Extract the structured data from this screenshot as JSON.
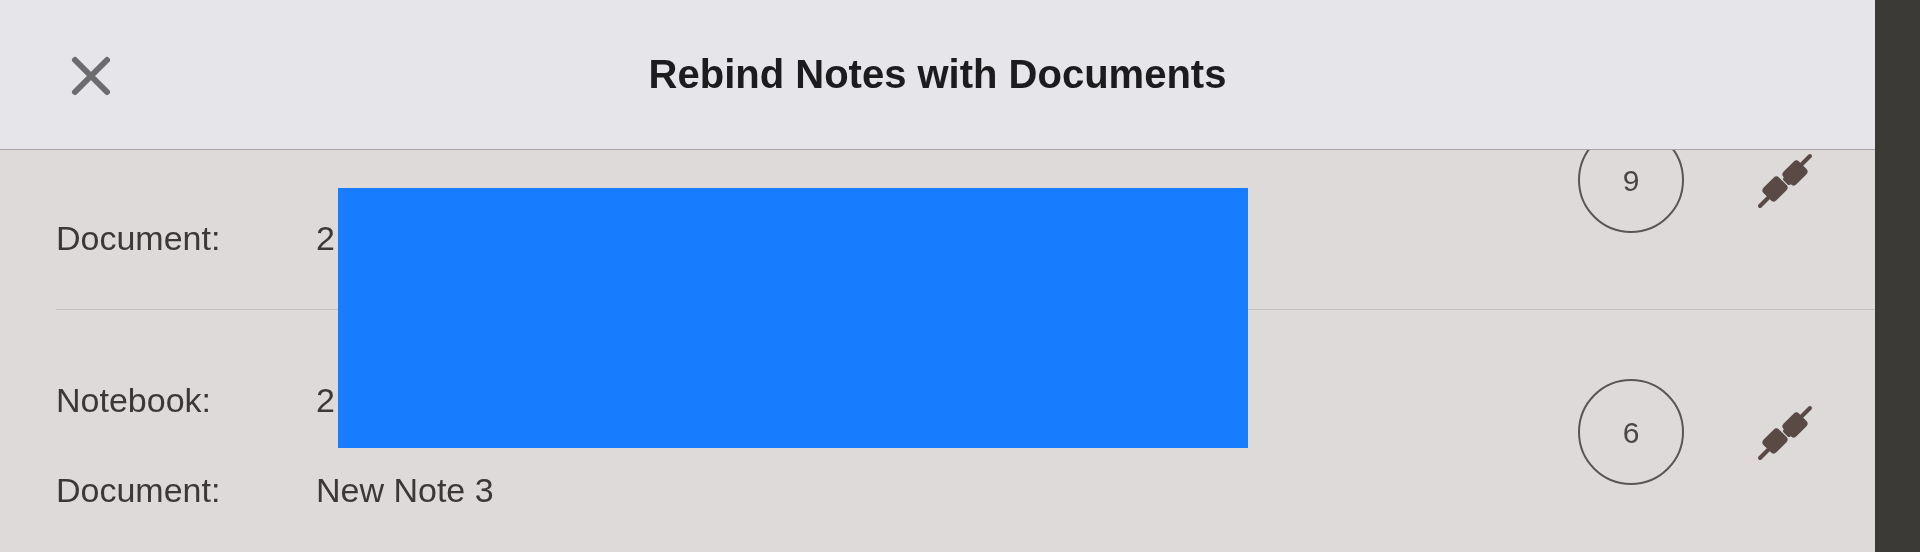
{
  "header": {
    "title": "Rebind Notes with Documents"
  },
  "rows": [
    {
      "fields": [
        {
          "label": "Document:",
          "value": "2"
        }
      ],
      "count": "9"
    },
    {
      "fields": [
        {
          "label": "Notebook:",
          "value": "2"
        },
        {
          "label": "Document:",
          "value": "New Note 3"
        }
      ],
      "count": "6"
    }
  ]
}
